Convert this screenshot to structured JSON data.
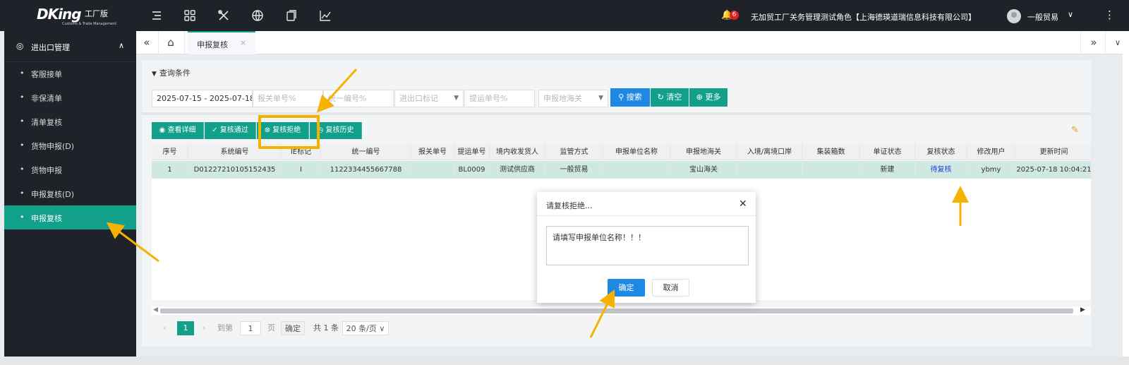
{
  "header": {
    "brand": "DKing",
    "edition": "工厂版",
    "tagline": "Customs & Trade Management",
    "notification_count": "6",
    "company": "无加贸工厂关务管理测试角色【上海德瑛道瑞信息科技有限公司】",
    "username": "一般贸易",
    "tools": [
      "menu-icon",
      "grid-icon",
      "tools-icon",
      "globe-icon",
      "copy-icon",
      "chart-icon"
    ]
  },
  "sidebar": {
    "group_label": "进出口管理",
    "items": [
      {
        "label": "客服接单"
      },
      {
        "label": "非保清单"
      },
      {
        "label": "清单复核"
      },
      {
        "label": "货物申报(D)"
      },
      {
        "label": "货物申报"
      },
      {
        "label": "申报复核(D)"
      },
      {
        "label": "申报复核"
      }
    ],
    "active_index": 6
  },
  "tabs": {
    "active_label": "申报复核"
  },
  "query": {
    "title": "查询条件",
    "date_range": "2025-07-15 - 2025-07-18",
    "customs_no_placeholder": "报关单号%",
    "unified_no_placeholder": "统一编号%",
    "ie_flag_placeholder": "进出口标记",
    "bl_no_placeholder": "提运单号%",
    "declare_customs_placeholder": "申报地海关",
    "search_label": "搜索",
    "clear_label": "清空",
    "more_label": "更多"
  },
  "actions": {
    "view_detail": "查看详细",
    "review_pass": "复核通过",
    "review_reject": "复核拒绝",
    "review_history": "复核历史"
  },
  "table": {
    "columns": [
      "序号",
      "系统编号",
      "IE标记",
      "统一编号",
      "报关单号",
      "提运单号",
      "境内收发货人",
      "监管方式",
      "申报单位名称",
      "申报地海关",
      "入境/离境口岸",
      "集装箱数",
      "单证状态",
      "复核状态",
      "修改用户",
      "更新时间"
    ],
    "rows": [
      [
        "1",
        "D01227210105152435",
        "I",
        "1122334455667788",
        "",
        "BL0009",
        "测试供应商",
        "一般贸易",
        "",
        "宝山海关",
        "",
        "",
        "新建",
        "待复核",
        "ybmy",
        "2025-07-18 10:04:21"
      ]
    ]
  },
  "pager": {
    "current_page": "1",
    "goto_label": "到第",
    "goto_value": "1",
    "page_unit": "页",
    "confirm_label": "确定",
    "total": "共 1 条",
    "page_size": "20 条/页"
  },
  "modal": {
    "title": "请复核拒绝...",
    "text": "请填写申报单位名称！！！",
    "ok_label": "确定",
    "cancel_label": "取消"
  },
  "colors": {
    "accent": "#13a08a",
    "primary_button": "#1e88e5",
    "topbar": "#1f2229",
    "annotation": "#f5b300",
    "link": "#1f3fd8"
  }
}
